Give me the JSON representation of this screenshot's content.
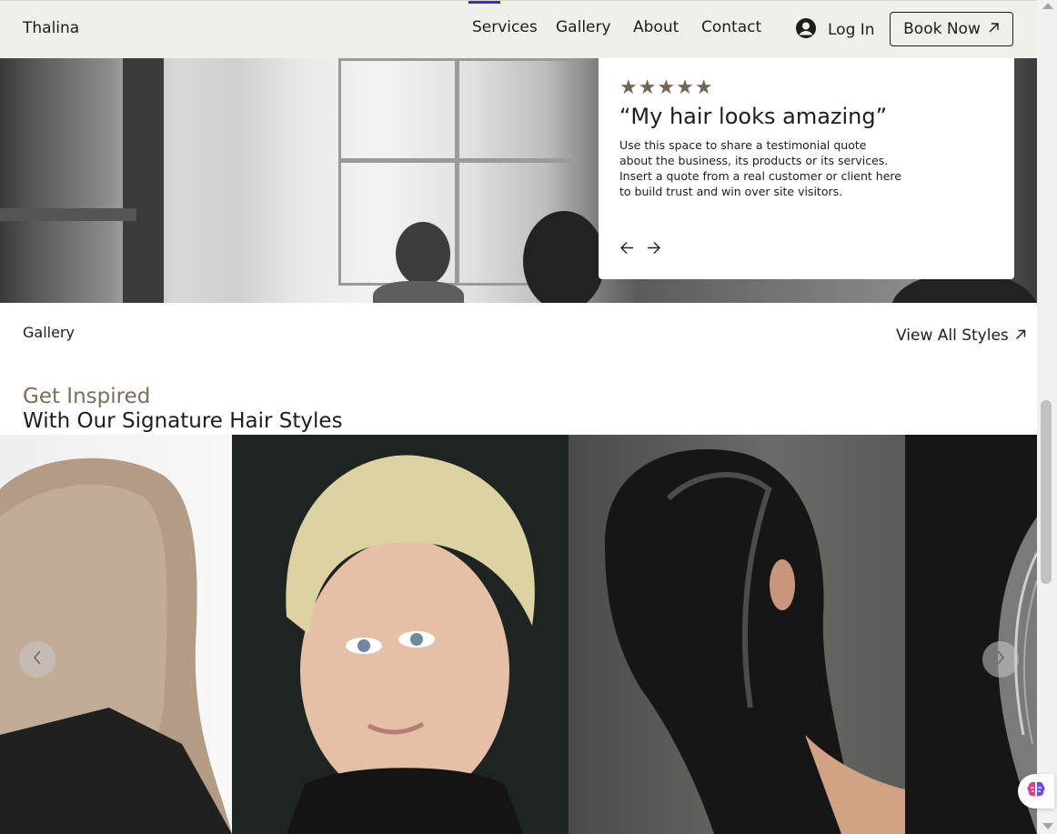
{
  "header": {
    "logo": "Thalina",
    "nav": [
      {
        "label": "Services"
      },
      {
        "label": "Gallery"
      },
      {
        "label": "About"
      },
      {
        "label": "Contact"
      }
    ],
    "login_label": "Log In",
    "book_label": "Book Now"
  },
  "testimonial": {
    "stars": "★★★★★",
    "rating": 5,
    "title": "“My hair looks amazing”",
    "body": "Use this space to share a testimonial quote about the business, its products or its services. Insert a quote from a real customer or client here to build trust and win over site visitors."
  },
  "gallery": {
    "section_label": "Gallery",
    "view_all_label": "View All Styles",
    "heading_accent": "Get Inspired",
    "heading_main": "With Our Signature Hair Styles"
  },
  "colors": {
    "header_bg": "#f1efe9",
    "accent_text": "#7a6f5c",
    "star_color": "#6d6555",
    "nav_indicator": "#3c2bd9"
  },
  "icons": {
    "user": "user-avatar-icon",
    "arrow_up_right": "arrow-up-right-icon",
    "prev": "arrow-left-icon",
    "next": "arrow-right-icon",
    "gallery_prev": "chevron-left-icon",
    "gallery_next": "chevron-right-icon",
    "ai": "brain-icon"
  }
}
